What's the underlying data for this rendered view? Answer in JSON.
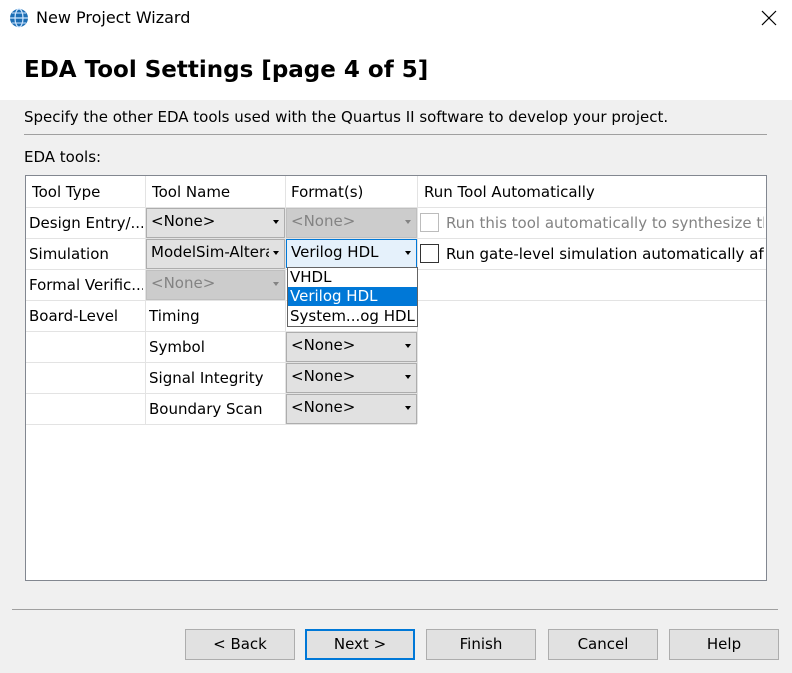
{
  "window": {
    "title": "New Project Wizard"
  },
  "page": {
    "title": "EDA Tool Settings [page 4 of 5]",
    "description": "Specify the other EDA tools used with the Quartus II software to develop your project.",
    "tools_label": "EDA tools:"
  },
  "table": {
    "headers": [
      "Tool Type",
      "Tool Name",
      "Format(s)",
      "Run Tool Automatically"
    ],
    "rows": [
      {
        "type": "Design Entry/...",
        "name": "<None>",
        "format": "<None>",
        "run": "Run this tool automatically to synthesize the c"
      },
      {
        "type": "Simulation",
        "name": "ModelSim-Altera",
        "format": "Verilog HDL",
        "run": "Run gate-level simulation automatically after"
      },
      {
        "type": "Formal Verific...",
        "name": "<None>",
        "format": "",
        "run": ""
      },
      {
        "type": "Board-Level",
        "name": "Timing",
        "format": "",
        "run": ""
      },
      {
        "type": "",
        "name": "Symbol",
        "format": "<None>",
        "run": ""
      },
      {
        "type": "",
        "name": "Signal Integrity",
        "format": "<None>",
        "run": ""
      },
      {
        "type": "",
        "name": "Boundary Scan",
        "format": "<None>",
        "run": ""
      }
    ]
  },
  "format_dropdown": {
    "options": [
      "VHDL",
      "Verilog HDL",
      "System...og HDL"
    ],
    "selected": "Verilog HDL"
  },
  "buttons": {
    "back": "< Back",
    "next": "Next >",
    "finish": "Finish",
    "cancel": "Cancel",
    "help": "Help"
  },
  "colors": {
    "accent": "#0078d7",
    "disabled_text": "#838383",
    "button_face": "#e1e1e1"
  },
  "icons": {
    "app": "quartus-globe-icon",
    "close": "close-icon",
    "dropdown": "chevron-down-icon"
  }
}
